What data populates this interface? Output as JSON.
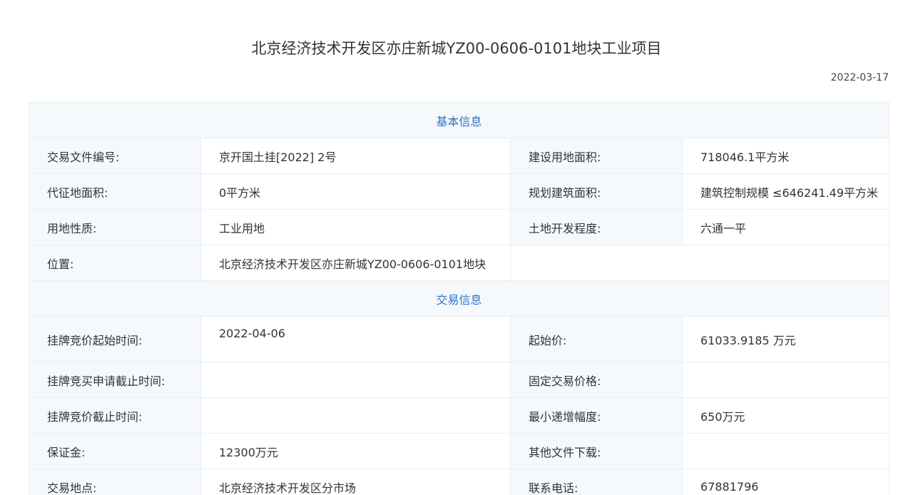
{
  "page": {
    "title": "北京经济技术开发区亦庄新城YZ00-0606-0101地块工业项目",
    "date": "2022-03-17"
  },
  "basic": {
    "section_title": "基本信息",
    "rows": [
      {
        "label1": "交易文件编号:",
        "value1": "京开国土挂[2022] 2号",
        "label2": "建设用地面积:",
        "value2": "718046.1平方米"
      },
      {
        "label1": "代征地面积:",
        "value1": "0平方米",
        "label2": "规划建筑面积:",
        "value2": "建筑控制规模 ≤646241.49平方米"
      },
      {
        "label1": "用地性质:",
        "value1": "工业用地",
        "label2": "土地开发程度:",
        "value2": "六通一平"
      },
      {
        "label1": "位置:",
        "value1": "北京经济技术开发区亦庄新城YZ00-0606-0101地块"
      }
    ]
  },
  "trade": {
    "section_title": "交易信息",
    "rows": [
      {
        "label1": "挂牌竞价起始时间:",
        "value1": "2022-04-06",
        "label2": "起始价:",
        "value2": "61033.9185 万元"
      },
      {
        "label1": "挂牌竞买申请截止时间:",
        "value1": "",
        "label2": "固定交易价格:",
        "value2": ""
      },
      {
        "label1": "挂牌竞价截止时间:",
        "value1": "",
        "label2": "最小递增幅度:",
        "value2": "650万元"
      },
      {
        "label1": "保证金:",
        "value1": "12300万元",
        "label2": "其他文件下载:",
        "value2": ""
      },
      {
        "label1": "交易地点:",
        "value1": "北京经济技术开发区分市场",
        "label2": "联系电话:",
        "value2": "67881796"
      }
    ]
  }
}
